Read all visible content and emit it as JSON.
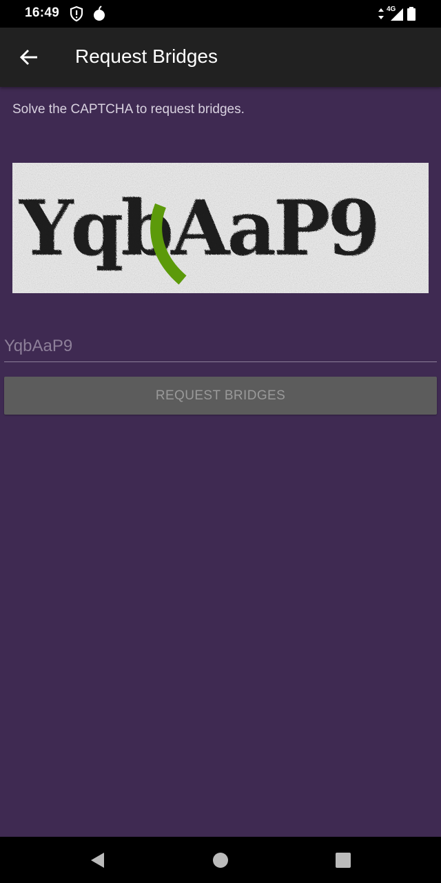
{
  "status_bar": {
    "time": "16:49",
    "network_label": "4G",
    "icons": [
      "shield-alert-icon",
      "tor-onion-icon",
      "data-arrows-icon",
      "signal-icon",
      "battery-icon"
    ]
  },
  "app_bar": {
    "title": "Request Bridges",
    "back_icon": "arrow-back-icon"
  },
  "main": {
    "instructions": "Solve the CAPTCHA to request bridges.",
    "captcha_text": "YqbAaP9",
    "input_placeholder": "YqbAaP9",
    "input_value": "",
    "request_button_label": "REQUEST BRIDGES",
    "request_button_enabled": false
  },
  "nav_bar": {
    "icons": [
      "back-triangle-icon",
      "home-circle-icon",
      "recents-square-icon"
    ]
  },
  "colors": {
    "background": "#3f2a52",
    "app_bar": "#212121",
    "button_disabled": "#5c5c5c",
    "captcha_stroke": "#5c9a0a"
  }
}
